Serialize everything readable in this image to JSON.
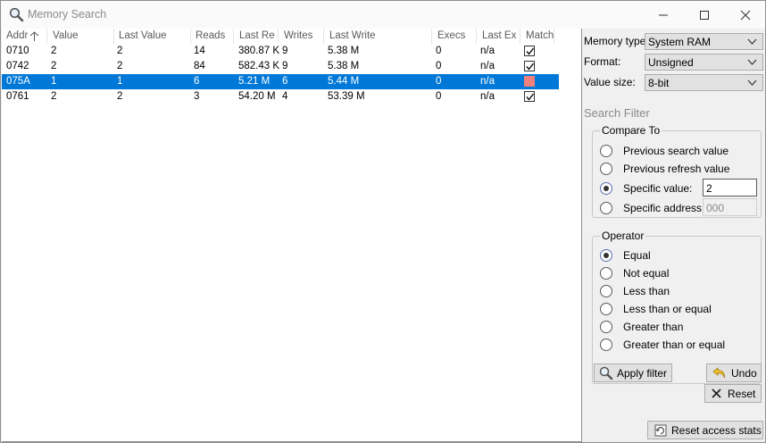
{
  "window": {
    "title": "Memory Search",
    "icon": "magnifier-icon"
  },
  "table": {
    "columns": [
      "Addr",
      "Value",
      "Last Value",
      "Reads",
      "Last Re",
      "Writes",
      "Last Write",
      "Execs",
      "Last Ex",
      "Match"
    ],
    "rows": [
      {
        "addr": "0710",
        "value": "2",
        "last_value": "2",
        "reads": "14",
        "last_read": "380.87 K",
        "writes": "9",
        "last_write": "5.38 M",
        "execs": "0",
        "last_exec": "n/a",
        "match": "true"
      },
      {
        "addr": "0742",
        "value": "2",
        "last_value": "2",
        "reads": "84",
        "last_read": "582.43 K",
        "writes": "9",
        "last_write": "5.38 M",
        "execs": "0",
        "last_exec": "n/a",
        "match": "true"
      },
      {
        "addr": "075A",
        "value": "1",
        "last_value": "1",
        "reads": "6",
        "last_read": "5.21 M",
        "writes": "6",
        "last_write": "5.44 M",
        "execs": "0",
        "last_exec": "n/a",
        "match": "false"
      },
      {
        "addr": "0761",
        "value": "2",
        "last_value": "2",
        "reads": "3",
        "last_read": "54.20 M",
        "writes": "4",
        "last_write": "53.39 M",
        "execs": "0",
        "last_exec": "n/a",
        "match": "true"
      }
    ],
    "selected_row": 2,
    "sort_column": "Addr",
    "sort_direction": "ascending"
  },
  "settings": {
    "memory_type_label": "Memory type:",
    "memory_type_value": "System RAM",
    "format_label": "Format:",
    "format_value": "Unsigned",
    "value_size_label": "Value size:",
    "value_size_value": "8-bit"
  },
  "search_filter": {
    "title": "Search Filter",
    "compare_to": {
      "title": "Compare To",
      "options": [
        "Previous search value",
        "Previous refresh value",
        "Specific value:",
        "Specific address:"
      ],
      "selected": "Specific value:",
      "specific_value": "2",
      "specific_address": "000"
    },
    "operator": {
      "title": "Operator",
      "options": [
        "Equal",
        "Not equal",
        "Less than",
        "Less than or equal",
        "Greater than",
        "Greater than or equal"
      ],
      "selected": "Equal"
    }
  },
  "buttons": {
    "apply_filter": "Apply filter",
    "undo": "Undo",
    "reset": "Reset",
    "reset_access_stats": "Reset access stats"
  },
  "colors": {
    "selection": "#0078d7",
    "match_fail": "#f08080"
  }
}
